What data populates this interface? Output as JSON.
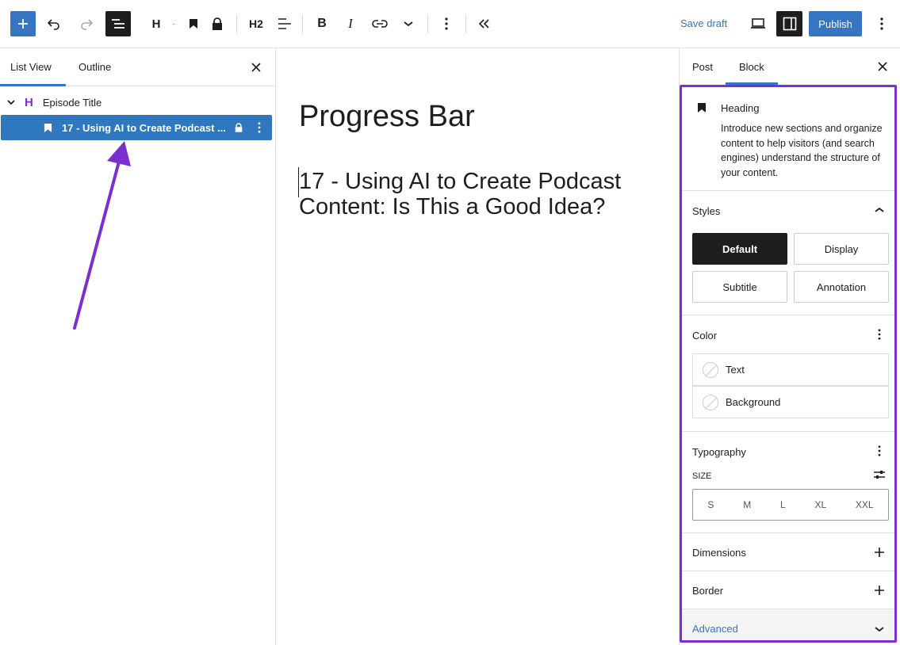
{
  "toolbar": {
    "heading_level": "H2",
    "save_draft_label": "Save draft",
    "publish_label": "Publish"
  },
  "left_panel": {
    "tabs": [
      {
        "label": "List View"
      },
      {
        "label": "Outline"
      }
    ],
    "items": [
      {
        "label": "Episode Title"
      },
      {
        "label": "17 - Using AI to Create Podcast ..."
      }
    ]
  },
  "editor": {
    "post_title": "Progress Bar",
    "heading_text": "17 - Using AI to Create Podcast Content: Is This a Good Idea?"
  },
  "sidebar": {
    "tabs": [
      {
        "label": "Post"
      },
      {
        "label": "Block"
      }
    ],
    "block": {
      "name": "Heading",
      "description": "Introduce new sections and organize content to help visitors (and search engines) understand the structure of your content."
    },
    "styles": {
      "title": "Styles",
      "options": [
        {
          "label": "Default"
        },
        {
          "label": "Display"
        },
        {
          "label": "Subtitle"
        },
        {
          "label": "Annotation"
        }
      ]
    },
    "color": {
      "title": "Color",
      "items": [
        {
          "label": "Text"
        },
        {
          "label": "Background"
        }
      ]
    },
    "typography": {
      "title": "Typography",
      "size_label": "SIZE",
      "sizes": [
        "S",
        "M",
        "L",
        "XL",
        "XXL"
      ]
    },
    "dimensions_title": "Dimensions",
    "border_title": "Border",
    "advanced_title": "Advanced"
  },
  "colors": {
    "accent": "#3575c2",
    "annotation": "#7b2fd1",
    "selected_row": "#2f78bf"
  }
}
